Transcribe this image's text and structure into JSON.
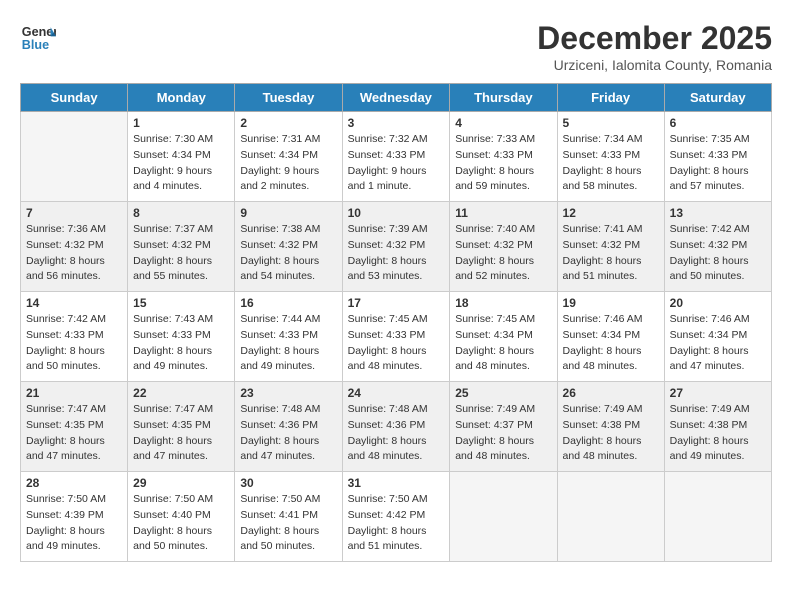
{
  "header": {
    "logo_line1": "General",
    "logo_line2": "Blue",
    "month": "December 2025",
    "location": "Urziceni, Ialomita County, Romania"
  },
  "days_of_week": [
    "Sunday",
    "Monday",
    "Tuesday",
    "Wednesday",
    "Thursday",
    "Friday",
    "Saturday"
  ],
  "weeks": [
    [
      {
        "day": "",
        "sunrise": "",
        "sunset": "",
        "daylight": "",
        "shaded": false,
        "empty": true
      },
      {
        "day": "1",
        "sunrise": "Sunrise: 7:30 AM",
        "sunset": "Sunset: 4:34 PM",
        "daylight": "Daylight: 9 hours and 4 minutes.",
        "shaded": false,
        "empty": false
      },
      {
        "day": "2",
        "sunrise": "Sunrise: 7:31 AM",
        "sunset": "Sunset: 4:34 PM",
        "daylight": "Daylight: 9 hours and 2 minutes.",
        "shaded": false,
        "empty": false
      },
      {
        "day": "3",
        "sunrise": "Sunrise: 7:32 AM",
        "sunset": "Sunset: 4:33 PM",
        "daylight": "Daylight: 9 hours and 1 minute.",
        "shaded": false,
        "empty": false
      },
      {
        "day": "4",
        "sunrise": "Sunrise: 7:33 AM",
        "sunset": "Sunset: 4:33 PM",
        "daylight": "Daylight: 8 hours and 59 minutes.",
        "shaded": false,
        "empty": false
      },
      {
        "day": "5",
        "sunrise": "Sunrise: 7:34 AM",
        "sunset": "Sunset: 4:33 PM",
        "daylight": "Daylight: 8 hours and 58 minutes.",
        "shaded": false,
        "empty": false
      },
      {
        "day": "6",
        "sunrise": "Sunrise: 7:35 AM",
        "sunset": "Sunset: 4:33 PM",
        "daylight": "Daylight: 8 hours and 57 minutes.",
        "shaded": false,
        "empty": false
      }
    ],
    [
      {
        "day": "7",
        "sunrise": "Sunrise: 7:36 AM",
        "sunset": "Sunset: 4:32 PM",
        "daylight": "Daylight: 8 hours and 56 minutes.",
        "shaded": true,
        "empty": false
      },
      {
        "day": "8",
        "sunrise": "Sunrise: 7:37 AM",
        "sunset": "Sunset: 4:32 PM",
        "daylight": "Daylight: 8 hours and 55 minutes.",
        "shaded": true,
        "empty": false
      },
      {
        "day": "9",
        "sunrise": "Sunrise: 7:38 AM",
        "sunset": "Sunset: 4:32 PM",
        "daylight": "Daylight: 8 hours and 54 minutes.",
        "shaded": true,
        "empty": false
      },
      {
        "day": "10",
        "sunrise": "Sunrise: 7:39 AM",
        "sunset": "Sunset: 4:32 PM",
        "daylight": "Daylight: 8 hours and 53 minutes.",
        "shaded": true,
        "empty": false
      },
      {
        "day": "11",
        "sunrise": "Sunrise: 7:40 AM",
        "sunset": "Sunset: 4:32 PM",
        "daylight": "Daylight: 8 hours and 52 minutes.",
        "shaded": true,
        "empty": false
      },
      {
        "day": "12",
        "sunrise": "Sunrise: 7:41 AM",
        "sunset": "Sunset: 4:32 PM",
        "daylight": "Daylight: 8 hours and 51 minutes.",
        "shaded": true,
        "empty": false
      },
      {
        "day": "13",
        "sunrise": "Sunrise: 7:42 AM",
        "sunset": "Sunset: 4:32 PM",
        "daylight": "Daylight: 8 hours and 50 minutes.",
        "shaded": true,
        "empty": false
      }
    ],
    [
      {
        "day": "14",
        "sunrise": "Sunrise: 7:42 AM",
        "sunset": "Sunset: 4:33 PM",
        "daylight": "Daylight: 8 hours and 50 minutes.",
        "shaded": false,
        "empty": false
      },
      {
        "day": "15",
        "sunrise": "Sunrise: 7:43 AM",
        "sunset": "Sunset: 4:33 PM",
        "daylight": "Daylight: 8 hours and 49 minutes.",
        "shaded": false,
        "empty": false
      },
      {
        "day": "16",
        "sunrise": "Sunrise: 7:44 AM",
        "sunset": "Sunset: 4:33 PM",
        "daylight": "Daylight: 8 hours and 49 minutes.",
        "shaded": false,
        "empty": false
      },
      {
        "day": "17",
        "sunrise": "Sunrise: 7:45 AM",
        "sunset": "Sunset: 4:33 PM",
        "daylight": "Daylight: 8 hours and 48 minutes.",
        "shaded": false,
        "empty": false
      },
      {
        "day": "18",
        "sunrise": "Sunrise: 7:45 AM",
        "sunset": "Sunset: 4:34 PM",
        "daylight": "Daylight: 8 hours and 48 minutes.",
        "shaded": false,
        "empty": false
      },
      {
        "day": "19",
        "sunrise": "Sunrise: 7:46 AM",
        "sunset": "Sunset: 4:34 PM",
        "daylight": "Daylight: 8 hours and 48 minutes.",
        "shaded": false,
        "empty": false
      },
      {
        "day": "20",
        "sunrise": "Sunrise: 7:46 AM",
        "sunset": "Sunset: 4:34 PM",
        "daylight": "Daylight: 8 hours and 47 minutes.",
        "shaded": false,
        "empty": false
      }
    ],
    [
      {
        "day": "21",
        "sunrise": "Sunrise: 7:47 AM",
        "sunset": "Sunset: 4:35 PM",
        "daylight": "Daylight: 8 hours and 47 minutes.",
        "shaded": true,
        "empty": false
      },
      {
        "day": "22",
        "sunrise": "Sunrise: 7:47 AM",
        "sunset": "Sunset: 4:35 PM",
        "daylight": "Daylight: 8 hours and 47 minutes.",
        "shaded": true,
        "empty": false
      },
      {
        "day": "23",
        "sunrise": "Sunrise: 7:48 AM",
        "sunset": "Sunset: 4:36 PM",
        "daylight": "Daylight: 8 hours and 47 minutes.",
        "shaded": true,
        "empty": false
      },
      {
        "day": "24",
        "sunrise": "Sunrise: 7:48 AM",
        "sunset": "Sunset: 4:36 PM",
        "daylight": "Daylight: 8 hours and 48 minutes.",
        "shaded": true,
        "empty": false
      },
      {
        "day": "25",
        "sunrise": "Sunrise: 7:49 AM",
        "sunset": "Sunset: 4:37 PM",
        "daylight": "Daylight: 8 hours and 48 minutes.",
        "shaded": true,
        "empty": false
      },
      {
        "day": "26",
        "sunrise": "Sunrise: 7:49 AM",
        "sunset": "Sunset: 4:38 PM",
        "daylight": "Daylight: 8 hours and 48 minutes.",
        "shaded": true,
        "empty": false
      },
      {
        "day": "27",
        "sunrise": "Sunrise: 7:49 AM",
        "sunset": "Sunset: 4:38 PM",
        "daylight": "Daylight: 8 hours and 49 minutes.",
        "shaded": true,
        "empty": false
      }
    ],
    [
      {
        "day": "28",
        "sunrise": "Sunrise: 7:50 AM",
        "sunset": "Sunset: 4:39 PM",
        "daylight": "Daylight: 8 hours and 49 minutes.",
        "shaded": false,
        "empty": false
      },
      {
        "day": "29",
        "sunrise": "Sunrise: 7:50 AM",
        "sunset": "Sunset: 4:40 PM",
        "daylight": "Daylight: 8 hours and 50 minutes.",
        "shaded": false,
        "empty": false
      },
      {
        "day": "30",
        "sunrise": "Sunrise: 7:50 AM",
        "sunset": "Sunset: 4:41 PM",
        "daylight": "Daylight: 8 hours and 50 minutes.",
        "shaded": false,
        "empty": false
      },
      {
        "day": "31",
        "sunrise": "Sunrise: 7:50 AM",
        "sunset": "Sunset: 4:42 PM",
        "daylight": "Daylight: 8 hours and 51 minutes.",
        "shaded": false,
        "empty": false
      },
      {
        "day": "",
        "sunrise": "",
        "sunset": "",
        "daylight": "",
        "shaded": false,
        "empty": true
      },
      {
        "day": "",
        "sunrise": "",
        "sunset": "",
        "daylight": "",
        "shaded": false,
        "empty": true
      },
      {
        "day": "",
        "sunrise": "",
        "sunset": "",
        "daylight": "",
        "shaded": false,
        "empty": true
      }
    ]
  ]
}
